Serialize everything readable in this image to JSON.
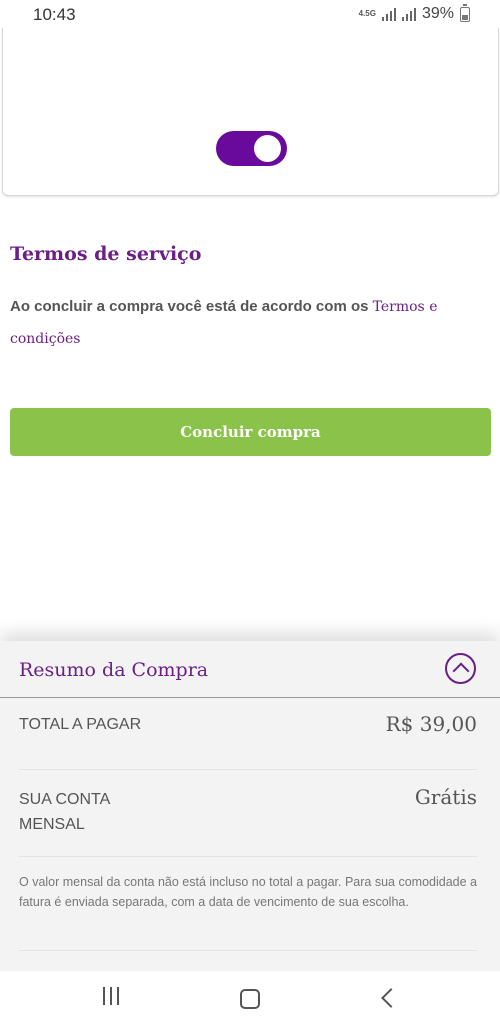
{
  "status_bar": {
    "time": "10:43",
    "network": "4.5G",
    "battery": "39%"
  },
  "plan_card": {
    "toggle_on": true,
    "toggle_color": "#6a0a9c"
  },
  "terms": {
    "title": "Termos de serviço",
    "text_prefix": "Ao concluir a compra você está de acordo com os ",
    "link_text": "Termos e condições"
  },
  "checkout": {
    "button_label": "Concluir compra",
    "button_color": "#8bc34a"
  },
  "summary": {
    "title": "Resumo da Compra",
    "total_label": "TOTAL A PAGAR",
    "total_value": "R$ 39,00",
    "monthly_label": "SUA CONTA MENSAL",
    "monthly_value": "Grátis",
    "note": "O valor mensal da conta não está incluso no total a pagar. Para sua comodidade a fatura é enviada separada, com a data de vencimento de sua escolha."
  },
  "icons": {
    "collapse": "chevron-up-circle-icon",
    "nav_recent": "recent-apps-icon",
    "nav_home": "home-icon",
    "nav_back": "back-icon"
  },
  "colors": {
    "brand_purple": "#6b1f86",
    "accent_green": "#8bc34a"
  }
}
